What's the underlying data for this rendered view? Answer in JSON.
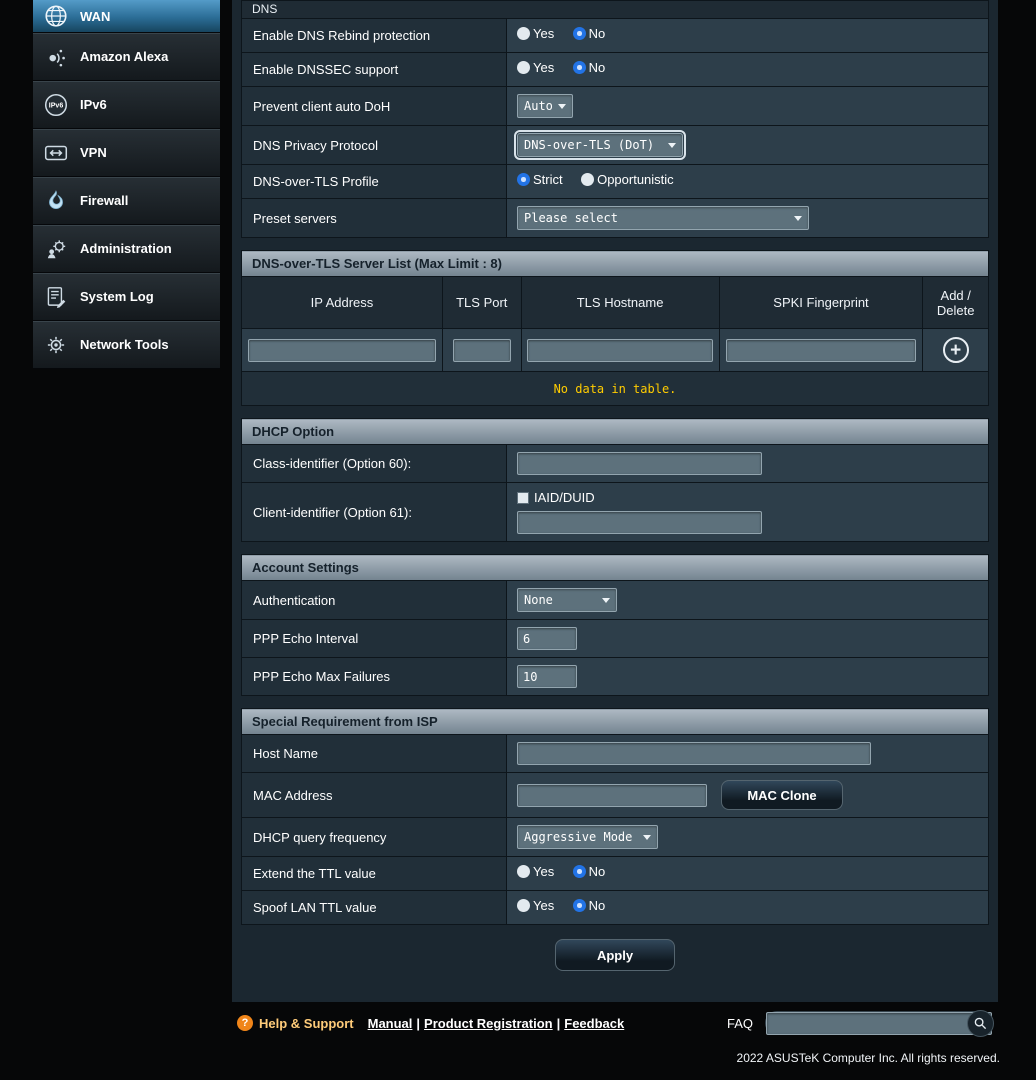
{
  "sidebar": {
    "items": [
      {
        "label": "WAN"
      },
      {
        "label": "Amazon Alexa"
      },
      {
        "label": "IPv6"
      },
      {
        "label": "VPN"
      },
      {
        "label": "Firewall"
      },
      {
        "label": "Administration"
      },
      {
        "label": "System Log"
      },
      {
        "label": "Network Tools"
      }
    ]
  },
  "common": {
    "yes": "Yes",
    "no": "No"
  },
  "dns": {
    "section_title": "DNS",
    "rebind_label": "Enable DNS Rebind protection",
    "rebind_value": "No",
    "dnssec_label": "Enable DNSSEC support",
    "dnssec_value": "No",
    "doh_label": "Prevent client auto DoH",
    "doh_value": "Auto",
    "privacy_label": "DNS Privacy Protocol",
    "privacy_value": "DNS-over-TLS (DoT)",
    "profile_label": "DNS-over-TLS Profile",
    "profile_strict": "Strict",
    "profile_opportunistic": "Opportunistic",
    "profile_value": "Strict",
    "preset_label": "Preset servers",
    "preset_value": "Please select"
  },
  "dot_list": {
    "title": "DNS-over-TLS Server List (Max Limit : 8)",
    "columns": {
      "ip": "IP Address",
      "port": "TLS Port",
      "hostname": "TLS Hostname",
      "spki": "SPKI Fingerprint",
      "add_line1": "Add /",
      "add_line2": "Delete"
    },
    "empty_text": "No data in table."
  },
  "dhcp": {
    "title": "DHCP Option",
    "class_label": "Class-identifier (Option 60):",
    "client_label": "Client-identifier (Option 61):",
    "iaid_label": "IAID/DUID"
  },
  "account": {
    "title": "Account Settings",
    "auth_label": "Authentication",
    "auth_value": "None",
    "echo_label": "PPP Echo Interval",
    "echo_value": "6",
    "fail_label": "PPP Echo Max Failures",
    "fail_value": "10"
  },
  "isp": {
    "title": "Special Requirement from ISP",
    "host_label": "Host Name",
    "mac_label": "MAC Address",
    "mac_clone_button": "MAC Clone",
    "freq_label": "DHCP query frequency",
    "freq_value": "Aggressive Mode",
    "ttl_label": "Extend the TTL value",
    "ttl_value": "No",
    "spoof_label": "Spoof LAN TTL value",
    "spoof_value": "No"
  },
  "apply_button": "Apply",
  "footer": {
    "help": "Help & Support",
    "help_icon": "?",
    "manual": "Manual",
    "registration": "Product Registration",
    "feedback": "Feedback",
    "separator": "|",
    "faq": "FAQ",
    "copyright": "2022 ASUSTeK Computer Inc. All rights reserved."
  },
  "colors": {
    "active_nav_blue": "#3f86b2",
    "radio_selected": "#2273e6",
    "empty_table_text": "#ffcc00",
    "section_bar_top": "#aeb9c3",
    "section_bar_bottom": "#73838f"
  }
}
